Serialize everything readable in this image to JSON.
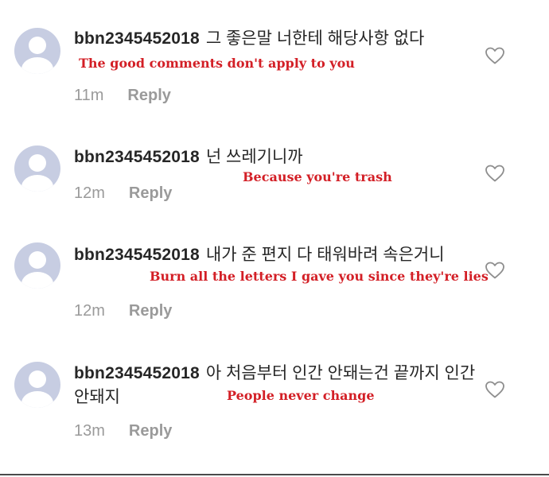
{
  "comments": [
    {
      "username": "bbn2345452018",
      "text": "그 좋은말 너한테 해당사항 없다",
      "translation": "The good comments don't apply to you",
      "time": "11m",
      "reply": "Reply",
      "like_icon": "heart-outline-icon"
    },
    {
      "username": "bbn2345452018",
      "text": "넌 쓰레기니까",
      "translation": "Because you're trash",
      "time": "12m",
      "reply": "Reply",
      "like_icon": "heart-outline-icon"
    },
    {
      "username": "bbn2345452018",
      "text": "내가 준 편지 다 태워바려 속은거니",
      "translation": "Burn all the letters I gave you since they're lies",
      "time": "12m",
      "reply": "Reply",
      "like_icon": "heart-outline-icon"
    },
    {
      "username": "bbn2345452018",
      "text": "아 처음부터 인간 안돼는건 끝까지 인간안돼지",
      "translation": "People never change",
      "time": "13m",
      "reply": "Reply",
      "like_icon": "heart-outline-icon"
    }
  ],
  "colors": {
    "username": "#262626",
    "translation": "#d31f26",
    "meta": "#9a9a9a",
    "avatar": "#c7cde2"
  }
}
